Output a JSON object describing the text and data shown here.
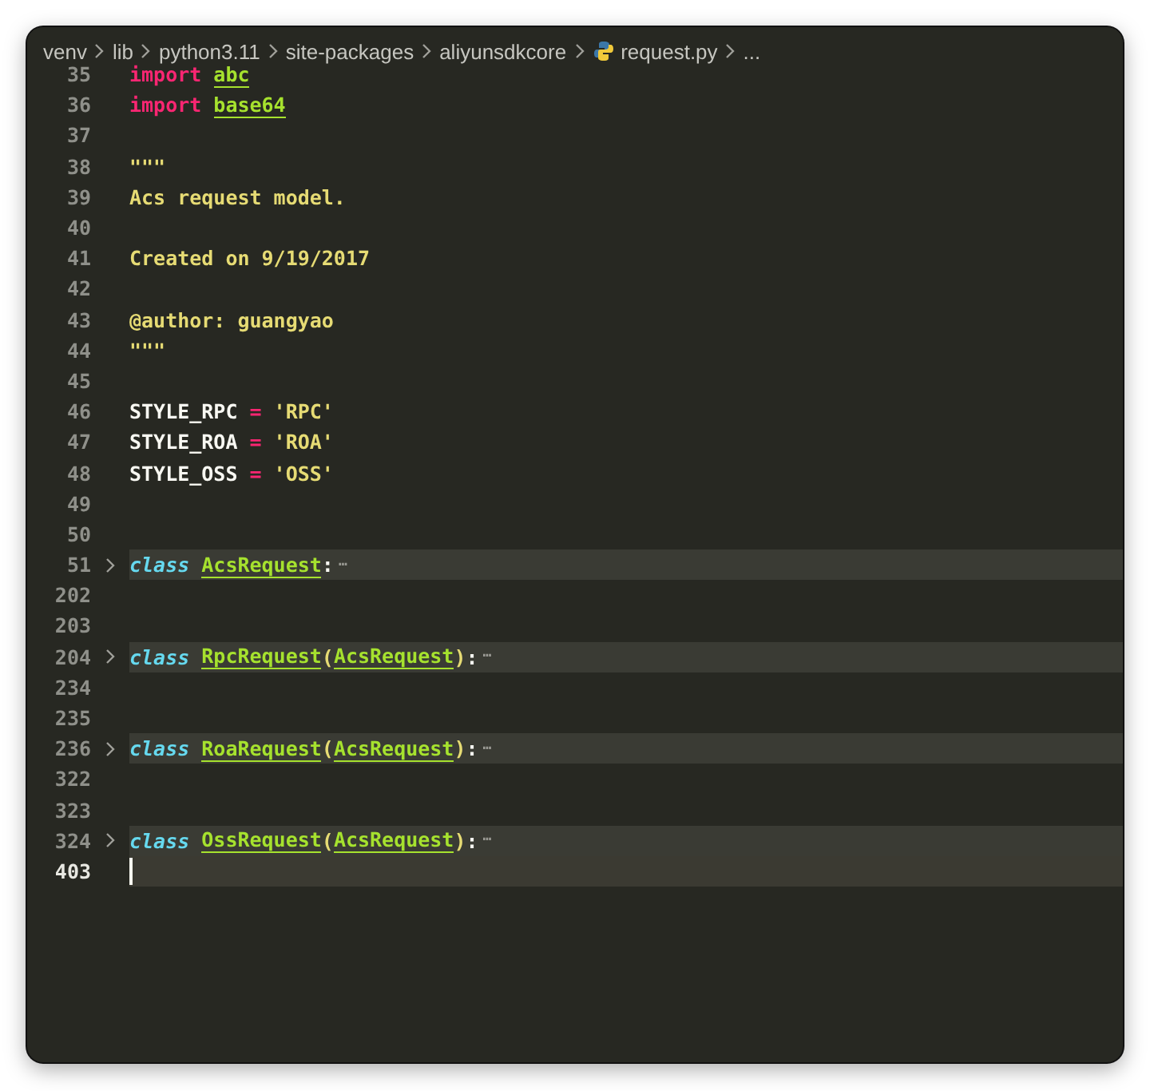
{
  "breadcrumb": [
    {
      "label": "venv",
      "kind": "folder"
    },
    {
      "label": "lib",
      "kind": "folder"
    },
    {
      "label": "python3.11",
      "kind": "folder"
    },
    {
      "label": "site-packages",
      "kind": "folder"
    },
    {
      "label": "aliyunsdkcore",
      "kind": "folder"
    },
    {
      "label": "request.py",
      "kind": "python-file"
    },
    {
      "label": "...",
      "kind": "more"
    }
  ],
  "lines": [
    {
      "number": "35",
      "folded": false,
      "current": false,
      "tokens": [
        {
          "kind": "keyword",
          "text": "import"
        },
        {
          "kind": "module",
          "text": "abc",
          "gap_before": true
        }
      ]
    },
    {
      "number": "36",
      "folded": false,
      "current": false,
      "tokens": [
        {
          "kind": "keyword",
          "text": "import"
        },
        {
          "kind": "module",
          "text": "base64",
          "gap_before": true
        }
      ]
    },
    {
      "number": "37",
      "folded": false,
      "current": false
    },
    {
      "number": "38",
      "folded": false,
      "current": false,
      "tokens": [
        {
          "kind": "docstring",
          "text": "\"\"\""
        }
      ]
    },
    {
      "number": "39",
      "folded": false,
      "current": false,
      "tokens": [
        {
          "kind": "docstring",
          "text": "Acs request model."
        }
      ]
    },
    {
      "number": "40",
      "folded": false,
      "current": false
    },
    {
      "number": "41",
      "folded": false,
      "current": false,
      "tokens": [
        {
          "kind": "docstring",
          "text": "Created on 9/19/2017"
        }
      ]
    },
    {
      "number": "42",
      "folded": false,
      "current": false
    },
    {
      "number": "43",
      "folded": false,
      "current": false,
      "tokens": [
        {
          "kind": "docstring",
          "text": "@author: guangyao"
        }
      ]
    },
    {
      "number": "44",
      "folded": false,
      "current": false,
      "tokens": [
        {
          "kind": "docstring",
          "text": "\"\"\""
        }
      ]
    },
    {
      "number": "45",
      "folded": false,
      "current": false
    },
    {
      "number": "46",
      "folded": false,
      "current": false,
      "tokens": [
        {
          "kind": "name",
          "text": "STYLE_RPC"
        },
        {
          "kind": "operator",
          "text": "=",
          "gap_before": true
        },
        {
          "kind": "string",
          "text": "'RPC'",
          "gap_before": true
        }
      ]
    },
    {
      "number": "47",
      "folded": false,
      "current": false,
      "tokens": [
        {
          "kind": "name",
          "text": "STYLE_ROA"
        },
        {
          "kind": "operator",
          "text": "=",
          "gap_before": true
        },
        {
          "kind": "string",
          "text": "'ROA'",
          "gap_before": true
        }
      ]
    },
    {
      "number": "48",
      "folded": false,
      "current": false,
      "tokens": [
        {
          "kind": "name",
          "text": "STYLE_OSS"
        },
        {
          "kind": "operator",
          "text": "=",
          "gap_before": true
        },
        {
          "kind": "string",
          "text": "'OSS'",
          "gap_before": true
        }
      ]
    },
    {
      "number": "49",
      "folded": false,
      "current": false
    },
    {
      "number": "50",
      "folded": false,
      "current": false
    },
    {
      "number": "51",
      "folded": true,
      "current": false,
      "tokens": [
        {
          "kind": "class-keyword",
          "text": "class"
        },
        {
          "kind": "class-name",
          "text": "AcsRequest",
          "gap_before": true
        },
        {
          "kind": "punct",
          "text": ":"
        },
        {
          "kind": "fold-ellipsis",
          "text": "⋯"
        }
      ]
    },
    {
      "number": "202",
      "folded": false,
      "current": false
    },
    {
      "number": "203",
      "folded": false,
      "current": false
    },
    {
      "number": "204",
      "folded": true,
      "current": false,
      "tokens": [
        {
          "kind": "class-keyword",
          "text": "class"
        },
        {
          "kind": "class-name",
          "text": "RpcRequest",
          "gap_before": true
        },
        {
          "kind": "paren",
          "text": "("
        },
        {
          "kind": "class-name",
          "text": "AcsRequest"
        },
        {
          "kind": "paren",
          "text": ")"
        },
        {
          "kind": "punct",
          "text": ":"
        },
        {
          "kind": "fold-ellipsis",
          "text": "⋯"
        }
      ]
    },
    {
      "number": "234",
      "folded": false,
      "current": false
    },
    {
      "number": "235",
      "folded": false,
      "current": false
    },
    {
      "number": "236",
      "folded": true,
      "current": false,
      "tokens": [
        {
          "kind": "class-keyword",
          "text": "class"
        },
        {
          "kind": "class-name",
          "text": "RoaRequest",
          "gap_before": true
        },
        {
          "kind": "paren",
          "text": "("
        },
        {
          "kind": "class-name",
          "text": "AcsRequest"
        },
        {
          "kind": "paren",
          "text": ")"
        },
        {
          "kind": "punct",
          "text": ":"
        },
        {
          "kind": "fold-ellipsis",
          "text": "⋯"
        }
      ]
    },
    {
      "number": "322",
      "folded": false,
      "current": false
    },
    {
      "number": "323",
      "folded": false,
      "current": false
    },
    {
      "number": "324",
      "folded": true,
      "current": false,
      "tokens": [
        {
          "kind": "class-keyword",
          "text": "class"
        },
        {
          "kind": "class-name",
          "text": "OssRequest",
          "gap_before": true
        },
        {
          "kind": "paren",
          "text": "("
        },
        {
          "kind": "class-name",
          "text": "AcsRequest"
        },
        {
          "kind": "paren",
          "text": ")"
        },
        {
          "kind": "punct",
          "text": ":"
        },
        {
          "kind": "fold-ellipsis",
          "text": "⋯"
        }
      ]
    },
    {
      "number": "403",
      "folded": false,
      "current": true
    }
  ]
}
